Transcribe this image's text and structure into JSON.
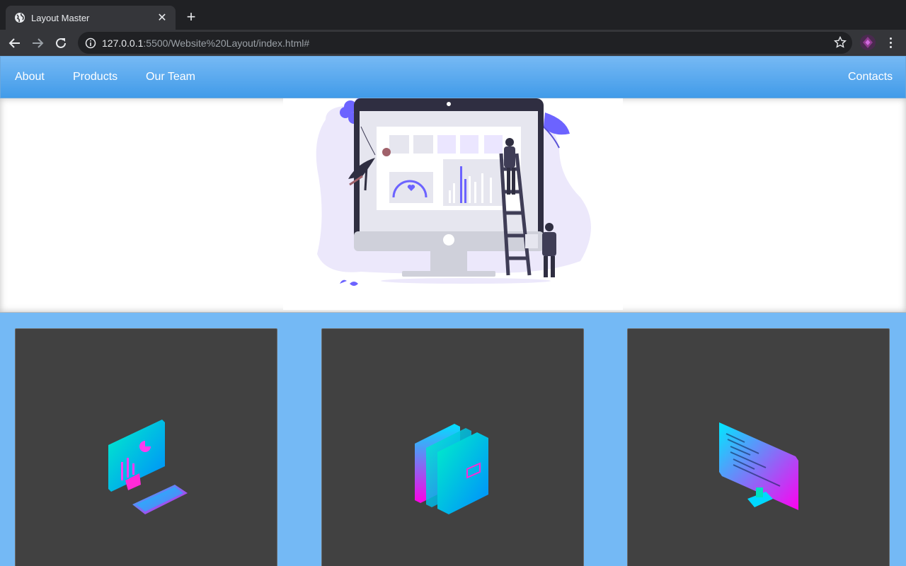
{
  "browser": {
    "tab_title": "Layout Master",
    "url_host": "127.0.0.1",
    "url_rest": ":5500/Website%20Layout/index.html#"
  },
  "nav": {
    "left": [
      "About",
      "Products",
      "Our Team"
    ],
    "right": "Contacts"
  },
  "hero": {
    "image": "dashboard-illustration"
  },
  "cards": [
    {
      "icon": "monitor-keyboard-icon"
    },
    {
      "icon": "folders-icon"
    },
    {
      "icon": "code-monitor-icon"
    }
  ],
  "colors": {
    "nav_gradient_top": "#76b9f4",
    "nav_gradient_bottom": "#419be9",
    "page_bg": "#74b9f5",
    "card_bg": "#414141",
    "illustration_accent": "#6c63ff"
  }
}
